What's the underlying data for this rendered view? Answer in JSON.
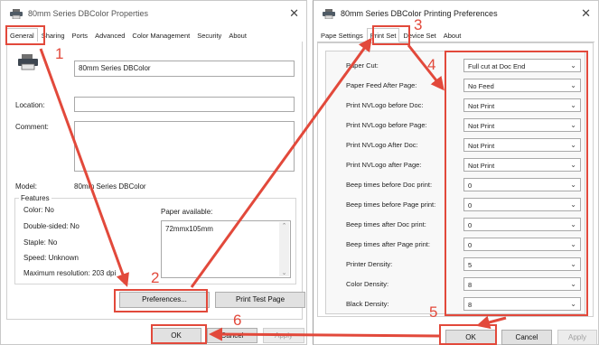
{
  "left_window": {
    "title": "80mm Series DBColor Properties",
    "tabs": [
      {
        "label": "General",
        "active": true
      },
      {
        "label": "Sharing",
        "active": false
      },
      {
        "label": "Ports",
        "active": false
      },
      {
        "label": "Advanced",
        "active": false
      },
      {
        "label": "Color Management",
        "active": false
      },
      {
        "label": "Security",
        "active": false
      },
      {
        "label": "About",
        "active": false
      }
    ],
    "printer_name": "80mm Series DBColor",
    "location_label": "Location:",
    "location_value": "",
    "comment_label": "Comment:",
    "comment_value": "",
    "model_label": "Model:",
    "model_value": "80mm Series DBColor",
    "features_label": "Features",
    "features": {
      "color": "Color: No",
      "double_sided": "Double-sided: No",
      "staple": "Staple: No",
      "speed": "Speed: Unknown",
      "max_resolution": "Maximum resolution: 203 dpi"
    },
    "paper_available_label": "Paper available:",
    "paper_available_items": [
      "72mmx105mm"
    ],
    "preferences_button": "Preferences...",
    "print_test_page_button": "Print Test Page",
    "ok_button": "OK",
    "cancel_button": "Cancel",
    "apply_button": "Apply"
  },
  "right_window": {
    "title": "80mm Series DBColor Printing Preferences",
    "tabs": [
      {
        "label": "Pape Settings",
        "active": false
      },
      {
        "label": "Print Set",
        "active": true
      },
      {
        "label": "Device Set",
        "active": false
      },
      {
        "label": "About",
        "active": false
      }
    ],
    "settings": [
      {
        "label": "Paper Cut:",
        "value": "Full cut at Doc End"
      },
      {
        "label": "Paper Feed After Page:",
        "value": "No Feed"
      },
      {
        "label": "Print NVLogo before Doc:",
        "value": "Not Print"
      },
      {
        "label": "Print NVLogo before Page:",
        "value": "Not Print"
      },
      {
        "label": "Print NVLogo After Doc:",
        "value": "Not Print"
      },
      {
        "label": "Print NVLogo after Page:",
        "value": "Not Print"
      },
      {
        "label": "Beep times before Doc print:",
        "value": "0"
      },
      {
        "label": "Beep times before Page print:",
        "value": "0"
      },
      {
        "label": "Beep times after Doc print:",
        "value": "0"
      },
      {
        "label": "Beep times after Page print:",
        "value": "0"
      },
      {
        "label": "Printer Density:",
        "value": "5"
      },
      {
        "label": "Color Density:",
        "value": "8"
      },
      {
        "label": "Black Density:",
        "value": "8"
      }
    ],
    "ok_button": "OK",
    "cancel_button": "Cancel",
    "apply_button": "Apply"
  },
  "annotations": {
    "step1": "1",
    "step2": "2",
    "step3": "3",
    "step4": "4",
    "step5": "5",
    "step6": "6"
  },
  "colors": {
    "annotation_red": "#e2493b",
    "window_bg": "#ffffff",
    "button_bg": "#e1e1e1"
  }
}
